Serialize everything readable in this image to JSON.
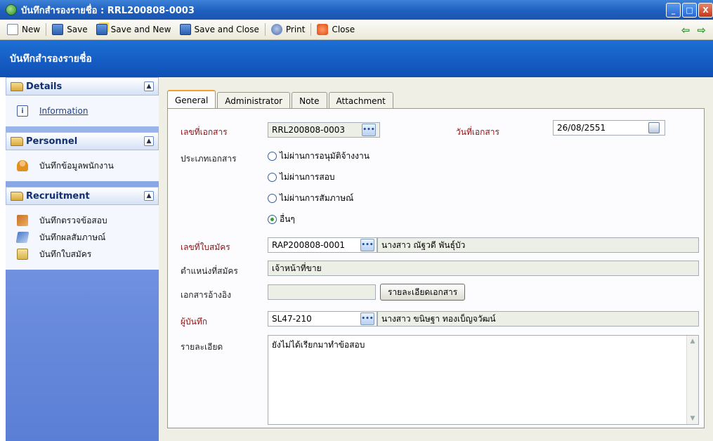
{
  "window": {
    "title": "บันทึกสำรองรายชื่อ : RRL200808-0003",
    "controls": [
      "_",
      "□",
      "X"
    ]
  },
  "toolbar": {
    "new_label": "New",
    "save_label": "Save",
    "save_new_label": "Save and New",
    "save_close_label": "Save and Close",
    "print_label": "Print",
    "close_label": "Close",
    "prev_arrow": "⇦",
    "next_arrow": "⇨"
  },
  "header": {
    "title": "บันทึกสำรองรายชื่อ"
  },
  "sidebar": {
    "sections": [
      {
        "label": "Details",
        "items": [
          {
            "label": "Information",
            "icon": "info-icon"
          }
        ]
      },
      {
        "label": "Personnel",
        "items": [
          {
            "label": "บันทึกข้อมูลพนักงาน",
            "icon": "person-icon"
          }
        ]
      },
      {
        "label": "Recruitment",
        "items": [
          {
            "label": "บันทึกตรวจข้อสอบ",
            "icon": "exam-icon"
          },
          {
            "label": "บันทึกผลสัมภาษณ์",
            "icon": "interview-icon"
          },
          {
            "label": "บันทึกใบสมัคร",
            "icon": "application-icon"
          }
        ]
      }
    ],
    "collapse_glyph": "▲"
  },
  "tabs": [
    "General",
    "Administrator",
    "Note",
    "Attachment"
  ],
  "form": {
    "doc_no_label": "เลขที่เอกสาร",
    "doc_no_value": "RRL200808-0003",
    "doc_date_label": "วันที่เอกสาร",
    "doc_date_value": "26/08/2551",
    "doc_type_label": "ประเภทเอกสาร",
    "doc_type_options": [
      "ไม่ผ่านการอนุมัติจ้างงาน",
      "ไม่ผ่านการสอบ",
      "ไม่ผ่านการสัมภาษณ์",
      "อื่นๆ"
    ],
    "doc_type_selected": "อื่นๆ",
    "applicant_no_label": "เลขที่ใบสมัคร",
    "applicant_no_value": "RAP200808-0001",
    "applicant_name": "นางสาว ณัฐวดี พันธุ์บัว",
    "position_label": "ตำแหน่งที่สมัคร",
    "position_value": "เจ้าหน้าที่ขาย",
    "reference_label": "เอกสารอ้างอิง",
    "reference_value": "",
    "reference_button": "รายละเอียดเอกสาร",
    "recorder_label": "ผู้บันทึก",
    "recorder_code": "SL47-210",
    "recorder_name": "นางสาว ขนิษฐา ทองเบ็ญจวัฒน์",
    "detail_label": "รายละเอียด",
    "detail_value": "ยังไม่ได้เรียกมาทำข้อสอบ",
    "lookup_glyph": "•••"
  }
}
